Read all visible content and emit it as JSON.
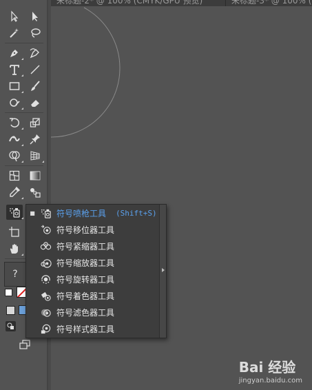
{
  "tabs": [
    {
      "label": "未标题-2* @ 100% (CMYK/GPU 预览)"
    },
    {
      "label": "未标题-3* @ 100% ("
    }
  ],
  "flyout": {
    "items": [
      {
        "label": "符号喷枪工具",
        "shortcut": "(Shift+S)",
        "selected": true,
        "icon": "symbol-sprayer-icon"
      },
      {
        "label": "符号移位器工具",
        "icon": "symbol-shifter-icon"
      },
      {
        "label": "符号紧缩器工具",
        "icon": "symbol-scruncher-icon"
      },
      {
        "label": "符号缩放器工具",
        "icon": "symbol-sizer-icon"
      },
      {
        "label": "符号旋转器工具",
        "icon": "symbol-spinner-icon"
      },
      {
        "label": "符号着色器工具",
        "icon": "symbol-stainer-icon"
      },
      {
        "label": "符号滤色器工具",
        "icon": "symbol-screener-icon"
      },
      {
        "label": "符号样式器工具",
        "icon": "symbol-styler-icon"
      }
    ]
  },
  "watermark": {
    "logo": "Bai 经验",
    "url": "jingyan.baidu.com"
  },
  "colors": {
    "canvas": "#535353",
    "menu_bg": "#3d3d3d",
    "highlight": "#5aa0ec"
  }
}
